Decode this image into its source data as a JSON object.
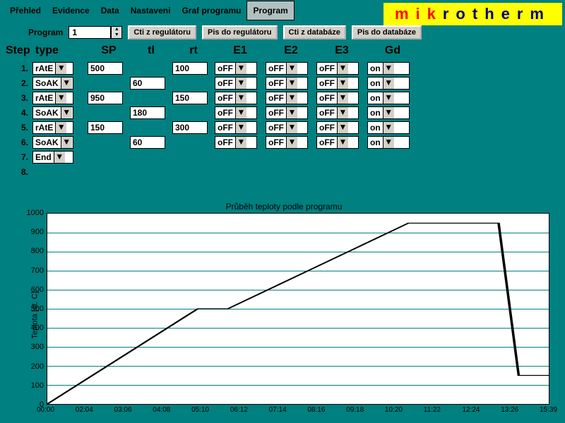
{
  "menubar": {
    "items": [
      "Přehled",
      "Evidence",
      "Data",
      "Nastaveni",
      "Graf programu",
      "Program"
    ],
    "active_index": 5
  },
  "brand": {
    "red": "mik",
    "blue": "rotherm"
  },
  "toolbar": {
    "program_label": "Program",
    "program_value": "1",
    "btn_read_reg": "Cti z regulátoru",
    "btn_write_reg": "Pis do regulátoru",
    "btn_read_db": "Cti z databáze",
    "btn_write_db": "Pis do databáze"
  },
  "columns": {
    "step": "Step",
    "type": "type",
    "sp": "SP",
    "tl": "tl",
    "rt": "rt",
    "e1": "E1",
    "e2": "E2",
    "e3": "E3",
    "gd": "Gd"
  },
  "rows": [
    {
      "n": "1.",
      "type": "rAtE",
      "sp": "500",
      "tl": "",
      "rt": "100",
      "e1": "oFF",
      "e2": "oFF",
      "e3": "oFF",
      "gd": "on"
    },
    {
      "n": "2.",
      "type": "SoAK",
      "sp": "",
      "tl": "60",
      "rt": "",
      "e1": "oFF",
      "e2": "oFF",
      "e3": "oFF",
      "gd": "on"
    },
    {
      "n": "3.",
      "type": "rAtE",
      "sp": "950",
      "tl": "",
      "rt": "150",
      "e1": "oFF",
      "e2": "oFF",
      "e3": "oFF",
      "gd": "on"
    },
    {
      "n": "4.",
      "type": "SoAK",
      "sp": "",
      "tl": "180",
      "rt": "",
      "e1": "oFF",
      "e2": "oFF",
      "e3": "oFF",
      "gd": "on"
    },
    {
      "n": "5.",
      "type": "rAtE",
      "sp": "150",
      "tl": "",
      "rt": "300",
      "e1": "oFF",
      "e2": "oFF",
      "e3": "oFF",
      "gd": "on"
    },
    {
      "n": "6.",
      "type": "SoAK",
      "sp": "",
      "tl": "60",
      "rt": "",
      "e1": "oFF",
      "e2": "oFF",
      "e3": "oFF",
      "gd": "on"
    },
    {
      "n": "7.",
      "type": "End",
      "sp": "",
      "tl": "",
      "rt": "",
      "e1": "",
      "e2": "",
      "e3": "",
      "gd": ""
    },
    {
      "n": "8.",
      "type": "",
      "sp": "",
      "tl": "",
      "rt": "",
      "e1": "",
      "e2": "",
      "e3": "",
      "gd": ""
    }
  ],
  "chart_data": {
    "type": "line",
    "title": "Průběh teploty podle programu",
    "ylabel": "Teplota [st. C]",
    "ylim": [
      0,
      1000
    ],
    "ytick_step": 100,
    "x_labels": [
      "00:00",
      "02:04",
      "03:06",
      "04:08",
      "05:10",
      "06:12",
      "07:14",
      "08:16",
      "09:18",
      "10:20",
      "11:22",
      "12:24",
      "13:26",
      "15:39"
    ],
    "series": [
      {
        "name": "temp",
        "x_min": [
          0,
          300,
          360,
          720,
          900,
          940,
          1000
        ],
        "y": [
          0,
          500,
          500,
          950,
          950,
          150,
          150
        ]
      }
    ]
  }
}
